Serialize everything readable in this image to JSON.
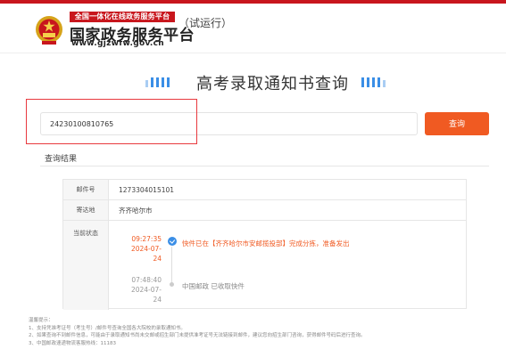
{
  "header": {
    "banner": "全国一体化在线政务服务平台",
    "site_name": "国家政务服务平台",
    "trial": "（试运行）",
    "domain": "www.gjzwfw.gov.cn"
  },
  "page_title": "高考录取通知书查询",
  "search": {
    "value": "24230100810765",
    "button_label": "查询"
  },
  "result_label": "查询结果",
  "result": {
    "mail_no_label": "邮件号",
    "mail_no": "1273304015101",
    "destination_label": "寄达地",
    "destination": "齐齐哈尔市",
    "status_label": "当前状态",
    "timeline": [
      {
        "time": "09:27:35",
        "date": "2024-07-24",
        "text": "快件已在【齐齐哈尔市安邮揽投部】完成分拣，准备发出",
        "active": true
      },
      {
        "time": "07:48:40",
        "date": "2024-07-24",
        "text": "中国邮政 已收取快件",
        "active": false
      }
    ]
  },
  "tips": {
    "title": "温馨提示：",
    "items": [
      "1、支持凭准考证号（考生号）/邮件号查询全国各大院校的录取通知书。",
      "2、如果查询不到邮件信息，可能由于录取通知书尚未交邮或招生部门未提供准考证号无法链接到邮件，建议您向招生部门咨询，获得邮件号码后进行查询。",
      "3、中国邮政速递物流客服热线：11183"
    ]
  },
  "colors": {
    "brand_red": "#c8161d",
    "accent_orange": "#f05a22",
    "accent_blue": "#3a8ee6"
  }
}
